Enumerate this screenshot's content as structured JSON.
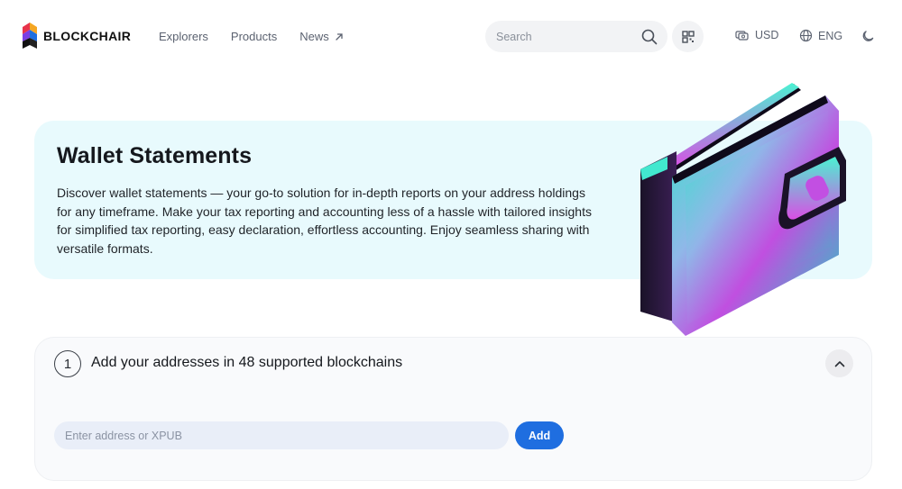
{
  "header": {
    "logo_text": "BLOCKCHAIR",
    "nav": [
      {
        "label": "Explorers"
      },
      {
        "label": "Products"
      },
      {
        "label": "News"
      }
    ],
    "search": {
      "placeholder": "Search"
    },
    "currency": "USD",
    "language": "ENG"
  },
  "hero": {
    "title": "Wallet Statements",
    "description": "Discover wallet statements — your go-to solution for in-depth reports on your address holdings for any timeframe. Make your tax reporting and accounting less of a hassle with tailored insights for simplified tax reporting, easy declaration, effortless accounting. Enjoy seamless sharing with versatile formats."
  },
  "step": {
    "number": "1",
    "title": "Add your addresses in 48 supported blockchains",
    "input_placeholder": "Enter address or XPUB",
    "add_label": "Add"
  },
  "colors": {
    "accent": "#1f6ee0",
    "hero_bg": "#e8fafd",
    "card_bg": "#f9fafc"
  },
  "icons": [
    "blockchair-logo-icon",
    "external-arrow-icon",
    "search-icon",
    "qr-code-icon",
    "currency-icon",
    "globe-icon",
    "moon-icon",
    "chevron-up-icon",
    "wallet-illustration"
  ]
}
